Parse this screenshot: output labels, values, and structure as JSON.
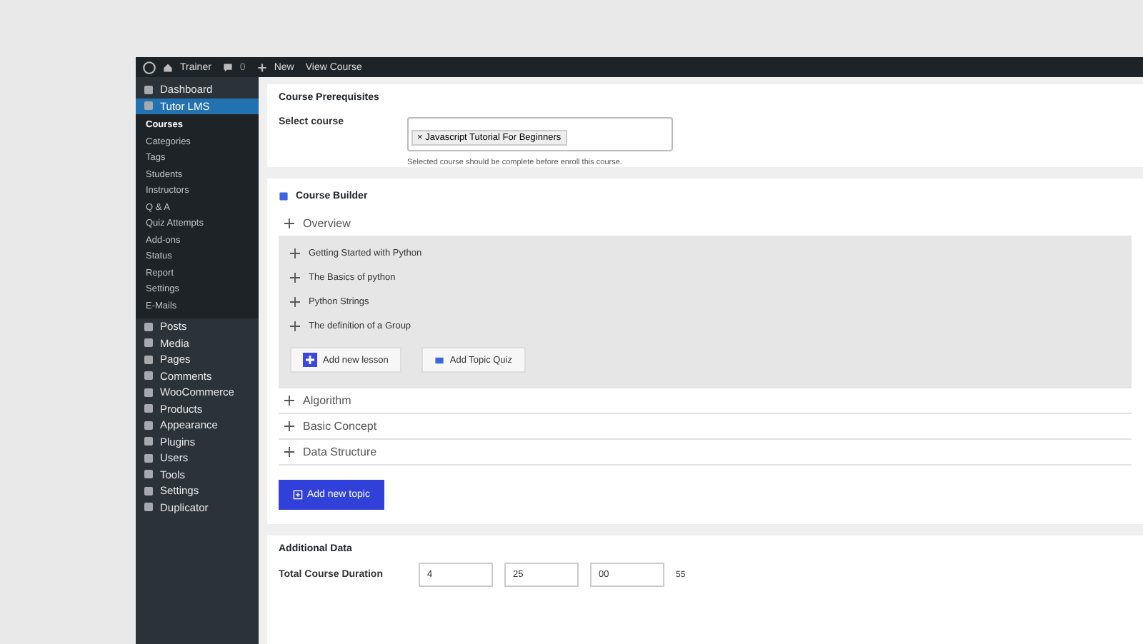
{
  "admin_bar": {
    "site": "Trainer",
    "comments": "0",
    "new": "New",
    "view": "View Course"
  },
  "sidebar": {
    "items": [
      {
        "label": "Dashboard",
        "selected": false
      },
      {
        "label": "Tutor LMS",
        "selected": true,
        "children": [
          {
            "label": "Courses",
            "selected": true
          },
          {
            "label": "Categories",
            "selected": false
          },
          {
            "label": "Tags",
            "selected": false
          },
          {
            "label": "Students",
            "selected": false
          },
          {
            "label": "Instructors",
            "selected": false
          },
          {
            "label": "Q & A",
            "selected": false
          },
          {
            "label": "Quiz Attempts",
            "selected": false
          },
          {
            "label": "Add-ons",
            "selected": false
          },
          {
            "label": "Status",
            "selected": false
          },
          {
            "label": "Report",
            "selected": false
          },
          {
            "label": "Settings",
            "selected": false
          },
          {
            "label": "E-Mails",
            "selected": false
          }
        ]
      },
      {
        "label": "Posts",
        "selected": false
      },
      {
        "label": "Media",
        "selected": false
      },
      {
        "label": "Pages",
        "selected": false
      },
      {
        "label": "Comments",
        "selected": false
      },
      {
        "label": "WooCommerce",
        "selected": false
      },
      {
        "label": "Products",
        "selected": false
      },
      {
        "label": "Appearance",
        "selected": false
      },
      {
        "label": "Plugins",
        "selected": false
      },
      {
        "label": "Users",
        "selected": false
      },
      {
        "label": "Tools",
        "selected": false
      },
      {
        "label": "Settings",
        "selected": false
      },
      {
        "label": "Duplicator",
        "selected": false
      }
    ]
  },
  "prerequisites": {
    "title": "Course Prerequisites",
    "label": "Select course",
    "tag_remove": "×",
    "tag": "Javascript Tutorial For Beginners",
    "help": "Selected course should be complete before enroll this course."
  },
  "builder": {
    "title": "Course Builder",
    "topics": [
      {
        "title": "Overview",
        "expanded": true,
        "lessons": [
          "Getting Started with Python",
          "The Basics of python",
          "Python Strings",
          "The definition of a Group"
        ],
        "add_lesson": "Add new lesson",
        "add_quiz": "Add Topic Quiz"
      },
      {
        "title": "Algorithm",
        "expanded": false
      },
      {
        "title": "Basic Concept",
        "expanded": false
      },
      {
        "title": "Data Structure",
        "expanded": false
      }
    ],
    "add_topic": "Add new topic"
  },
  "additional": {
    "title": "Additional Data",
    "duration_label": "Total Course Duration",
    "fields": [
      "4",
      "25",
      "00"
    ],
    "extra": "55"
  }
}
